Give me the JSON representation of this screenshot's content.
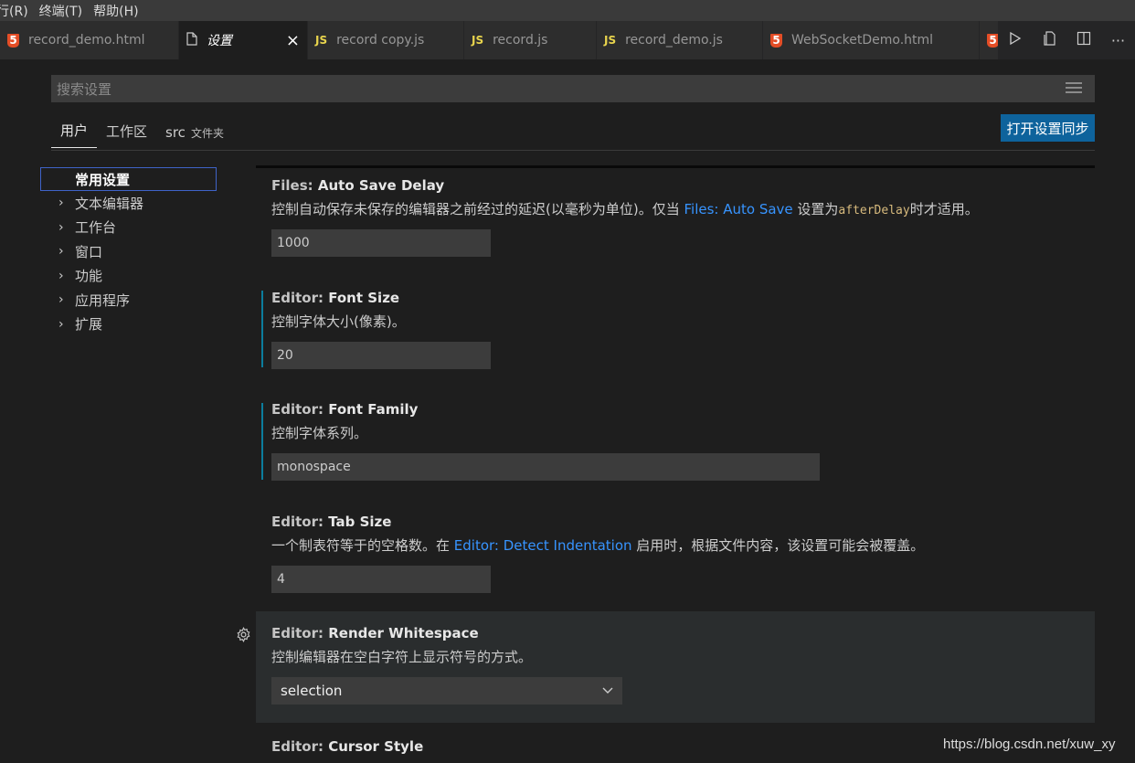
{
  "menubar": [
    "行(R)",
    "终端(T)",
    "帮助(H)"
  ],
  "tabs": [
    {
      "label": "record_demo.html",
      "icon": "html5-icon"
    },
    {
      "label": "设置",
      "icon": "file-icon",
      "active": true
    },
    {
      "label": "record copy.js",
      "icon": "js-icon"
    },
    {
      "label": "record.js",
      "icon": "js-icon"
    },
    {
      "label": "record_demo.js",
      "icon": "js-icon"
    },
    {
      "label": "WebSocketDemo.html",
      "icon": "html5-icon"
    }
  ],
  "tab_close_glyph": "×",
  "search": {
    "placeholder": "搜索设置"
  },
  "scopes": {
    "user": "用户",
    "workspace": "工作区",
    "folder": "src",
    "folder_suffix": "文件夹"
  },
  "sync_button": "打开设置同步",
  "toc": [
    "常用设置",
    "文本编辑器",
    "工作台",
    "窗口",
    "功能",
    "应用程序",
    "扩展"
  ],
  "settings": {
    "auto_save_delay": {
      "category": "Files: ",
      "name": "Auto Save Delay",
      "desc_a": "控制自动保存未保存的编辑器之前经过的延迟(以毫秒为单位)。仅当 ",
      "desc_link": "Files: Auto Save",
      "desc_b": " 设置为",
      "desc_code": "afterDelay",
      "desc_c": "时才适用。",
      "value": "1000"
    },
    "font_size": {
      "category": "Editor: ",
      "name": "Font Size",
      "desc": "控制字体大小(像素)。",
      "value": "20"
    },
    "font_family": {
      "category": "Editor: ",
      "name": "Font Family",
      "desc": "控制字体系列。",
      "value": "monospace"
    },
    "tab_size": {
      "category": "Editor: ",
      "name": "Tab Size",
      "desc_a": "一个制表符等于的空格数。在 ",
      "desc_link": "Editor: Detect Indentation",
      "desc_b": " 启用时，根据文件内容，该设置可能会被覆盖。",
      "value": "4"
    },
    "render_whitespace": {
      "category": "Editor: ",
      "name": "Render Whitespace",
      "desc": "控制编辑器在空白字符上显示符号的方式。",
      "value": "selection"
    },
    "cursor_style": {
      "category": "Editor: ",
      "name": "Cursor Style"
    }
  },
  "watermark": "https://blog.csdn.net/xuw_xy",
  "colors": {
    "accent": "#0e639c",
    "link": "#3794ff",
    "modified_bar": "#0c7d9d",
    "selection_border": "#3f63c8"
  }
}
